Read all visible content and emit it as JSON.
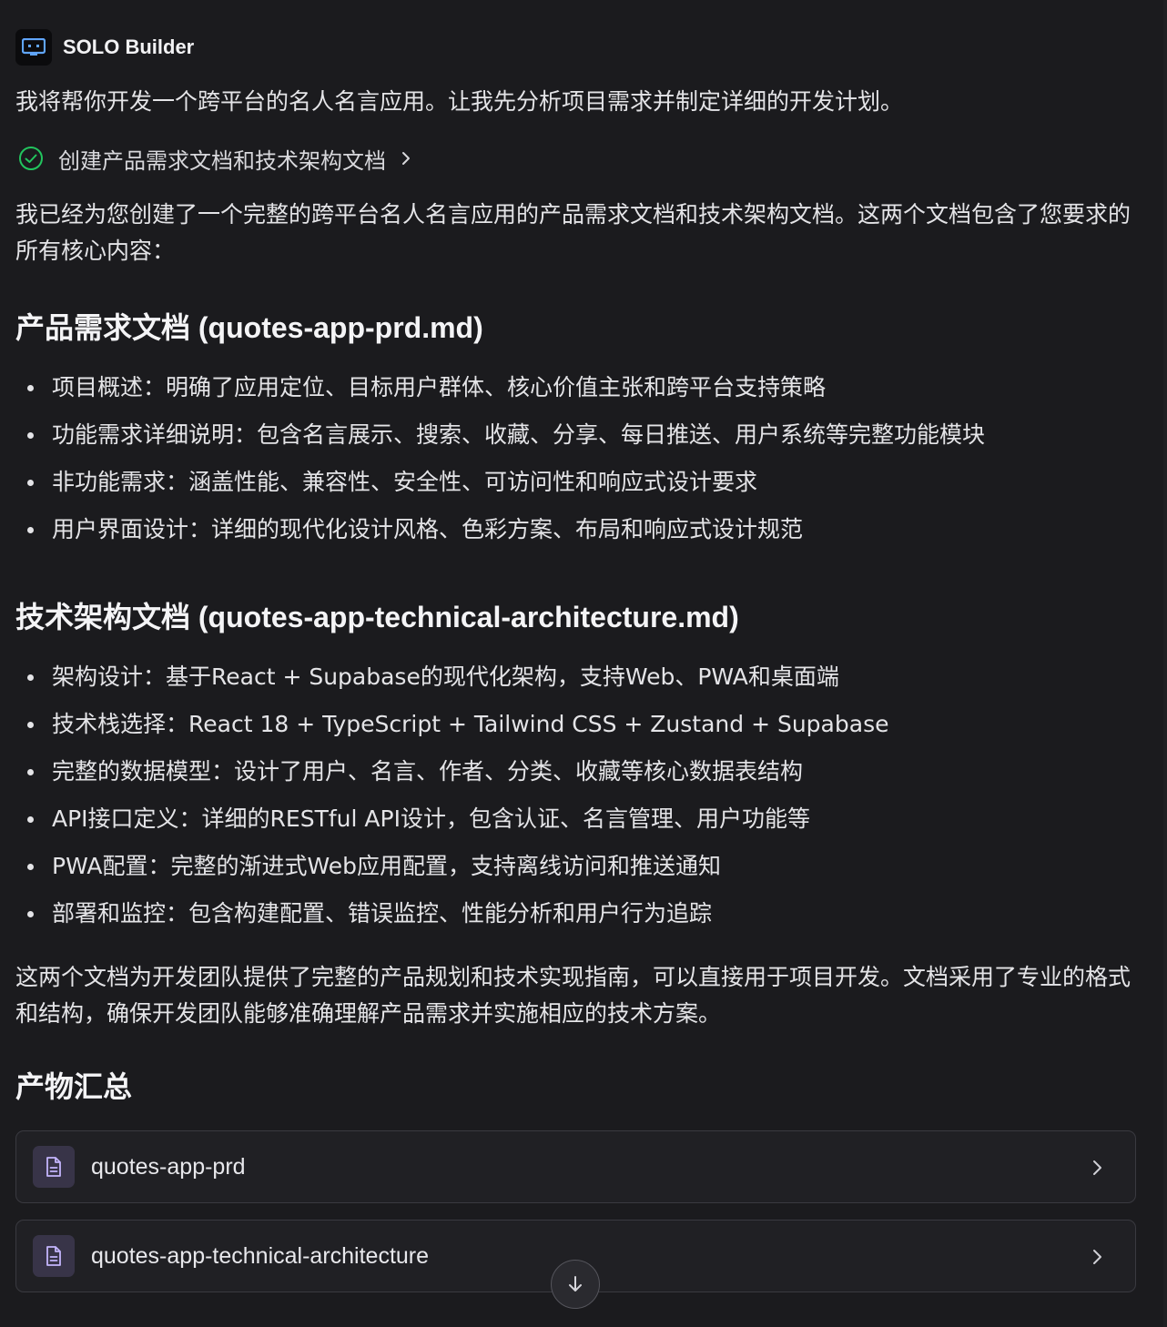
{
  "header": {
    "brand": "SOLO Builder"
  },
  "intro": "我将帮你开发一个跨平台的名人名言应用。让我先分析项目需求并制定详细的开发计划。",
  "task": {
    "label": "创建产品需求文档和技术架构文档",
    "status": "completed"
  },
  "summary": "我已经为您创建了一个完整的跨平台名人名言应用的产品需求文档和技术架构文档。这两个文档包含了您要求的所有核心内容：",
  "prd": {
    "heading": "产品需求文档 (quotes-app-prd.md)",
    "items": [
      "项目概述：明确了应用定位、目标用户群体、核心价值主张和跨平台支持策略",
      "功能需求详细说明：包含名言展示、搜索、收藏、分享、每日推送、用户系统等完整功能模块",
      "非功能需求：涵盖性能、兼容性、安全性、可访问性和响应式设计要求",
      "用户界面设计：详细的现代化设计风格、色彩方案、布局和响应式设计规范"
    ]
  },
  "tech": {
    "heading": "技术架构文档 (quotes-app-technical-architecture.md)",
    "items": [
      "架构设计：基于React + Supabase的现代化架构，支持Web、PWA和桌面端",
      "技术栈选择：React 18 + TypeScript + Tailwind CSS + Zustand + Supabase",
      "完整的数据模型：设计了用户、名言、作者、分类、收藏等核心数据表结构",
      "API接口定义：详细的RESTful API设计，包含认证、名言管理、用户功能等",
      "PWA配置：完整的渐进式Web应用配置，支持离线访问和推送通知",
      "部署和监控：包含构建配置、错误监控、性能分析和用户行为追踪"
    ]
  },
  "closing": "这两个文档为开发团队提供了完整的产品规划和技术实现指南，可以直接用于项目开发。文档采用了专业的格式和结构，确保开发团队能够准确理解产品需求并实施相应的技术方案。",
  "outputs": {
    "heading": "产物汇总",
    "items": [
      {
        "label": "quotes-app-prd",
        "icon": "document-icon"
      },
      {
        "label": "quotes-app-technical-architecture",
        "icon": "document-icon"
      }
    ]
  },
  "colors": {
    "background": "#1b1b1e",
    "check": "#22c55e",
    "file_icon_bg": "#383448",
    "file_icon_stroke": "#c4b5fd",
    "logo_accent": "#60a5fa"
  }
}
